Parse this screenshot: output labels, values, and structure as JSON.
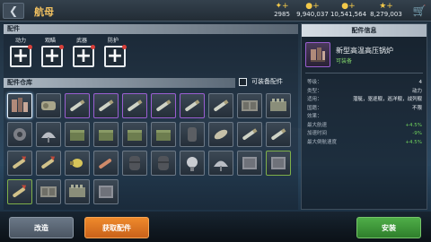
{
  "header": {
    "title": "航母",
    "back_icon": "back-arrow-icon",
    "currencies": [
      {
        "icon": "medal-icon",
        "value": "2985"
      },
      {
        "icon": "gold-coin-icon",
        "value": "9,940,037"
      },
      {
        "icon": "silver-coin-icon",
        "value": "10,541,564"
      },
      {
        "icon": "star-icon",
        "value": "8,279,003"
      }
    ],
    "shop_icon": "shopping-cart-icon"
  },
  "parts": {
    "heading": "配件",
    "slots": [
      {
        "label": "动力",
        "icon": "plus-icon"
      },
      {
        "label": "观瞄",
        "icon": "plus-icon"
      },
      {
        "label": "武器",
        "icon": "plus-icon"
      },
      {
        "label": "防护",
        "icon": "plus-icon"
      }
    ]
  },
  "inventory": {
    "heading": "配件仓库",
    "filter_label": "可装备配件",
    "rows": [
      [
        "boiler",
        "turbine",
        "shell-long",
        "shell-long",
        "shell-long",
        "shell-long",
        "shell-long",
        "shell-long",
        "crate",
        "engine-block"
      ],
      [
        "gear",
        "radar-dish",
        "ammo-box",
        "ammo-box",
        "ammo-box",
        "ammo-box",
        "canister",
        "torpedo-short",
        "shell-long",
        "shell-long"
      ],
      [
        "rocket",
        "rocket",
        "warhead",
        "torpedo",
        "drum",
        "drum",
        "searchlight",
        "radar-dish",
        "armor-plate",
        "armor-plate"
      ],
      [
        "rocket",
        "crate",
        "engine-block",
        "armor-plate"
      ]
    ]
  },
  "detail": {
    "heading": "配件信息",
    "name": "新型高温高压锅炉",
    "status": "可装备",
    "stats": [
      {
        "key": "等级：",
        "value": "4"
      },
      {
        "key": "类型：",
        "value": "动力"
      },
      {
        "key": "适用：",
        "value": "潜艇，驱逐舰，巡洋舰，战列舰"
      },
      {
        "key": "国籍：",
        "value": "不限"
      },
      {
        "key": "效果：",
        "value": ""
      },
      {
        "key": "最大航速",
        "value": "+4.5%"
      },
      {
        "key": "加速时间",
        "value": "-9%"
      },
      {
        "key": "最大倒航速度",
        "value": "+4.5%"
      }
    ]
  },
  "footer": {
    "modify_label": "改造",
    "get_label": "获取配件",
    "install_label": "安装"
  },
  "colors": {
    "orange": "#ef8a2c",
    "green": "#4fae48",
    "purple_rarity": "#9a5ed1",
    "green_rarity": "#7fb04a"
  }
}
